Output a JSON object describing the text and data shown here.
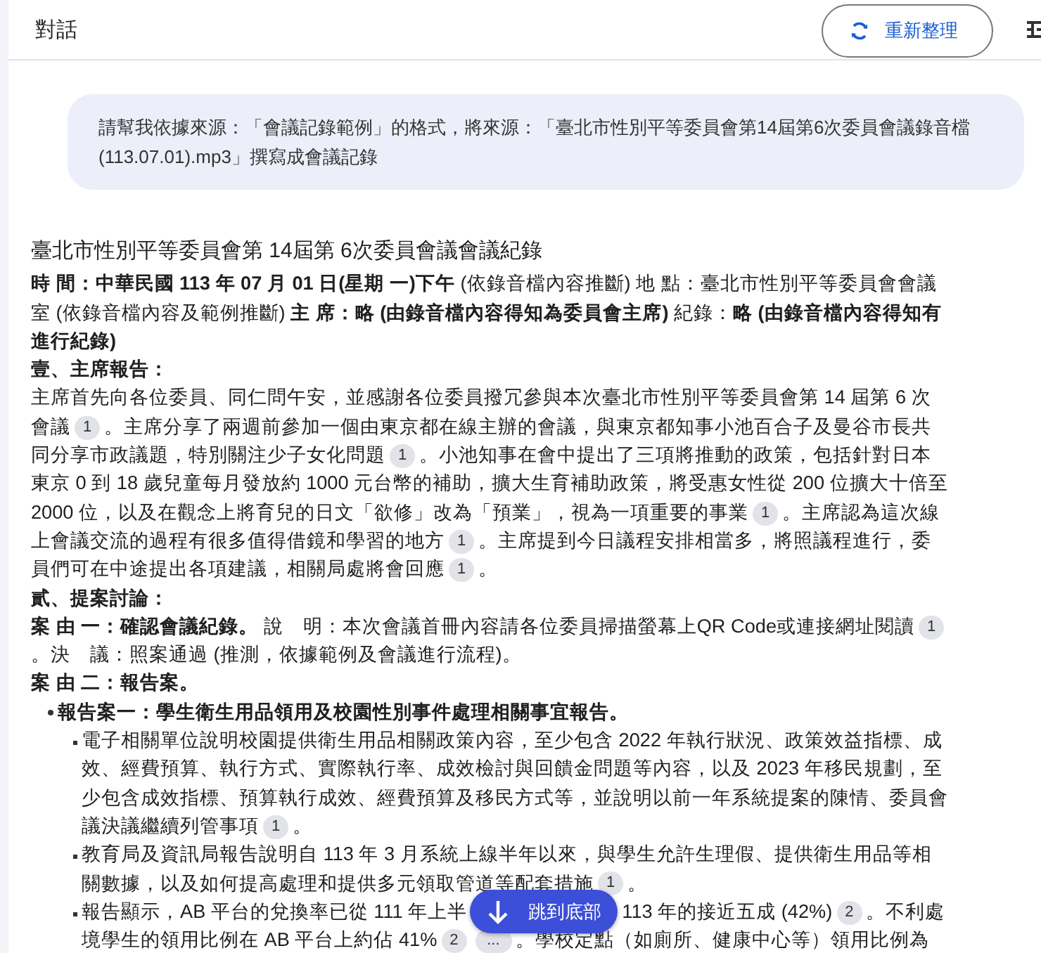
{
  "header": {
    "title": "對話",
    "refresh_button": "重新整理"
  },
  "prompt": "請幫我依據來源：「會議記錄範例」的格式，將來源：「臺北市性別平等委員會第14屆第6次委員會議錄音檔(113.07.01).mp3」撰寫成會議記錄",
  "response": {
    "title": "臺北市性別平等委員會第 14屆第 6次委員會議會議紀錄",
    "blocks": [
      {
        "kind": "para",
        "parts": [
          {
            "kind": "text",
            "text": "**時 間：中華民國 113 年 07 月 01 日(星期 一)下午** (依錄音檔內容推斷) 地 點：臺北市性別平等委員會會議室 (依錄音檔內容及範例推斷) **主 席：略 (由錄音檔內容得知為委員會主席)** 紀錄：**略 (由錄音檔內容得知有進行紀錄)**"
          }
        ]
      },
      {
        "kind": "heading",
        "text": "壹、主席報告："
      },
      {
        "kind": "para",
        "parts": [
          {
            "kind": "text",
            "text": "主席首先向各位委員、同仁問午安，並感謝各位委員撥冗參與本次臺北市性別平等委員會第 14 屆第 6 次會議"
          },
          {
            "kind": "cite",
            "text": "1"
          },
          {
            "kind": "text",
            "text": "。主席分享了兩週前參加一個由東京都在線主辦的會議，與東京都知事小池百合子及曼谷市長共同分享市政議題，特別關注少子女化問題"
          },
          {
            "kind": "cite",
            "text": "1"
          },
          {
            "kind": "text",
            "text": "。小池知事在會中提出了三項將推動的政策，包括針對日本東京 0 到 18 歲兒童每月發放約 1000 元台幣的補助，擴大生育補助政策，將受惠女性從 200 位擴大十倍至 2000 位，以及在觀念上將育兒的日文「欲修」改為「預業」，視為一項重要的事業"
          },
          {
            "kind": "cite",
            "text": "1"
          },
          {
            "kind": "text",
            "text": "。主席認為這次線上會議交流的過程有很多值得借鏡和學習的地方"
          },
          {
            "kind": "cite",
            "text": "1"
          },
          {
            "kind": "text",
            "text": "。主席提到今日議程安排相當多，將照議程進行，委員們可在中途提出各項建議，相關局處將會回應"
          },
          {
            "kind": "cite",
            "text": "1"
          },
          {
            "kind": "text",
            "text": "。"
          }
        ]
      },
      {
        "kind": "heading",
        "text": "貳、提案討論："
      },
      {
        "kind": "para",
        "parts": [
          {
            "kind": "text",
            "text": "**案 由 一：確認會議紀錄。** 說　明：本次會議首冊內容請各位委員掃描螢幕上QR Code或連接網址閱讀"
          },
          {
            "kind": "cite",
            "text": "1"
          },
          {
            "kind": "text",
            "text": "。決　議：照案通過 (推測，依據範例及會議進行流程)。"
          }
        ]
      },
      {
        "kind": "heading",
        "text": "案 由 二：報告案。"
      },
      {
        "kind": "bullet",
        "text": "報告案一：學生衛生用品領用及校園性別事件處理相關事宜報告。",
        "children": [
          {
            "parts": [
              {
                "kind": "text",
                "text": "電子相關單位說明校園提供衛生用品相關政策內容，至少包含 2022 年執行狀況、政策效益指標、成效、經費預算、執行方式、實際執行率、成效檢討與回饋金問題等內容，以及 2023 年移民規劃，至少包含成效指標、預算執行成效、經費預算及移民方式等，並說明以前一年系統提案的陳情、委員會議決議繼續列管事項"
              },
              {
                "kind": "cite",
                "text": "1"
              },
              {
                "kind": "text",
                "text": "。"
              }
            ]
          },
          {
            "parts": [
              {
                "kind": "text",
                "text": "教育局及資訊局報告說明自 113 年 3 月系統上線半年以來，與學生允許生理假、提供衛生用品等相關數據，以及如何提高處理和提供多元領取管道等配套措施"
              },
              {
                "kind": "cite",
                "text": "1"
              },
              {
                "kind": "text",
                "text": "。"
              }
            ]
          },
          {
            "parts": [
              {
                "kind": "text",
                "text": "報告顯示，AB 平台的兌換率已從 111 年上半"
              },
              {
                "kind": "gap"
              },
              {
                "kind": "text",
                "text": "113 年的接近五成 (42%)"
              },
              {
                "kind": "cite",
                "text": "2"
              },
              {
                "kind": "text",
                "text": "。不利處境學生的領用比例在 AB 平台上約佔 41%"
              },
              {
                "kind": "cite",
                "text": "2"
              },
              {
                "kind": "more",
                "text": "..."
              },
              {
                "kind": "text",
                "text": "。學校定點（如廁所、健康中心等）領用比例為"
              }
            ]
          }
        ]
      }
    ]
  },
  "jump_button": "跳到底部"
}
